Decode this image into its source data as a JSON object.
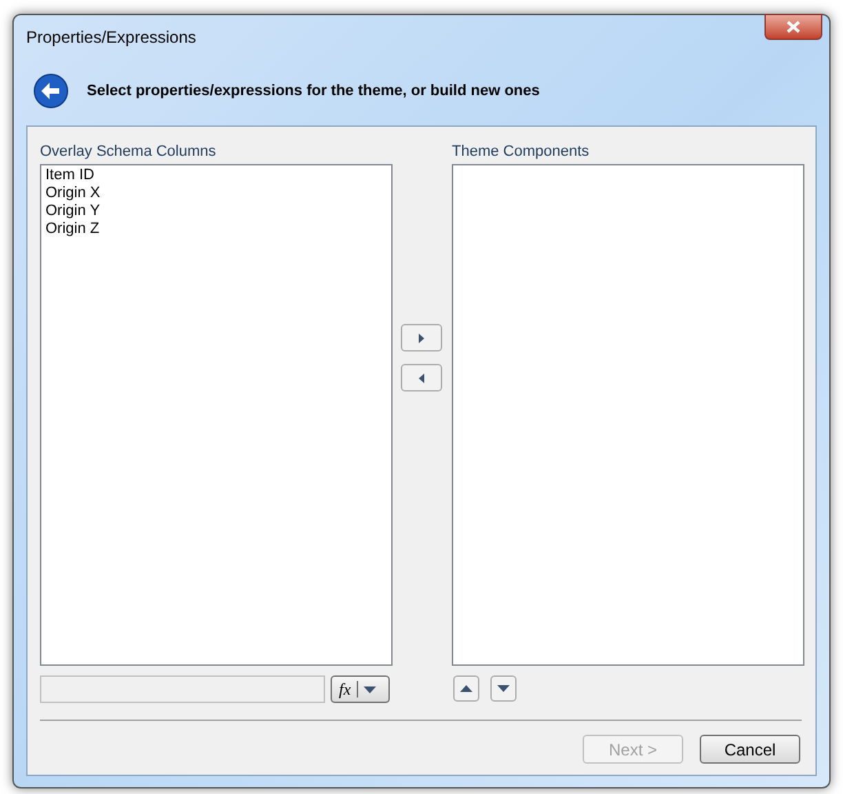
{
  "window": {
    "title": "Properties/Expressions"
  },
  "header": {
    "text": "Select properties/expressions for the theme, or build new ones"
  },
  "source_list": {
    "label": "Overlay Schema Columns",
    "items": [
      "Item ID",
      "Origin X",
      "Origin Y",
      "Origin Z"
    ]
  },
  "target_list": {
    "label": "Theme Components"
  },
  "function_button": {
    "label": "fx"
  },
  "footer_buttons": [
    {
      "label": "Next >",
      "disabled": true
    },
    {
      "label": "Cancel",
      "disabled": false
    }
  ]
}
